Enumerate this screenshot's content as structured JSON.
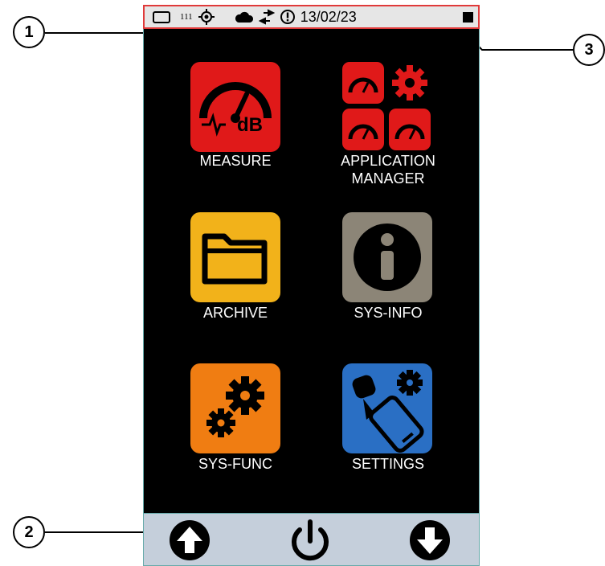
{
  "status_bar": {
    "battery_icon": "battery-icon",
    "small_value": "111",
    "gps_icon": "gps-icon",
    "cloud_icon": "cloud-icon",
    "transfer_icon": "transfer-arrows-icon",
    "alert_icon": "alert-icon",
    "date": "13/02/23",
    "storage_icon": "storage-square-icon"
  },
  "menu": {
    "measure": {
      "label": "MEASURE",
      "color": "#e01919"
    },
    "app_manager": {
      "label_line1": "APPLICATION",
      "label_line2": "MANAGER",
      "color": "#e01919"
    },
    "archive": {
      "label": "ARCHIVE",
      "color": "#f2b21a"
    },
    "sys_info": {
      "label": "SYS-INFO",
      "color": "#8c8577"
    },
    "sys_func": {
      "label": "SYS-FUNC",
      "color": "#f07d12"
    },
    "settings": {
      "label": "SETTINGS",
      "color": "#2a6fc4"
    }
  },
  "measure_icon_text": "dB",
  "bottom_bar": {
    "up_icon": "arrow-up-icon",
    "power_icon": "power-icon",
    "down_icon": "arrow-down-icon"
  },
  "callouts": [
    "1",
    "2",
    "3"
  ]
}
